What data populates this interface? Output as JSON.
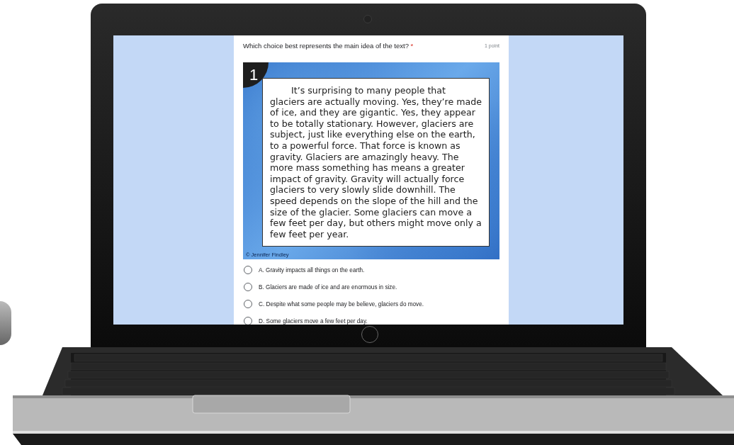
{
  "question": {
    "text": "Which choice best represents the main idea of the text?",
    "required_mark": "*",
    "points": "1 point"
  },
  "passage_card": {
    "number": "1",
    "text": "It’s surprising to many people that glaciers are actually moving. Yes, they’re made of ice, and they are gigantic. Yes, they appear to be totally stationary. However, glaciers are subject, just like everything else on the earth, to a powerful force. That force is known as gravity. Glaciers are amazingly heavy. The more mass something has means a greater impact of gravity. Gravity will actually force glaciers to very slowly slide downhill. The speed depends on the slope of the hill and the size of the glacier. Some glaciers can move a few feet per day, but others might move only a few feet per year.",
    "credit": "© Jennifer Findley"
  },
  "options": [
    {
      "label": "A. Gravity impacts all things on the earth.",
      "selected": false
    },
    {
      "label": "B. Glaciers are made of ice and are enormous in size.",
      "selected": false
    },
    {
      "label": "C. Despite what some people may be believe, glaciers do move.",
      "selected": false
    },
    {
      "label": "D. Some glaciers move a few feet per day.",
      "selected": false
    }
  ]
}
